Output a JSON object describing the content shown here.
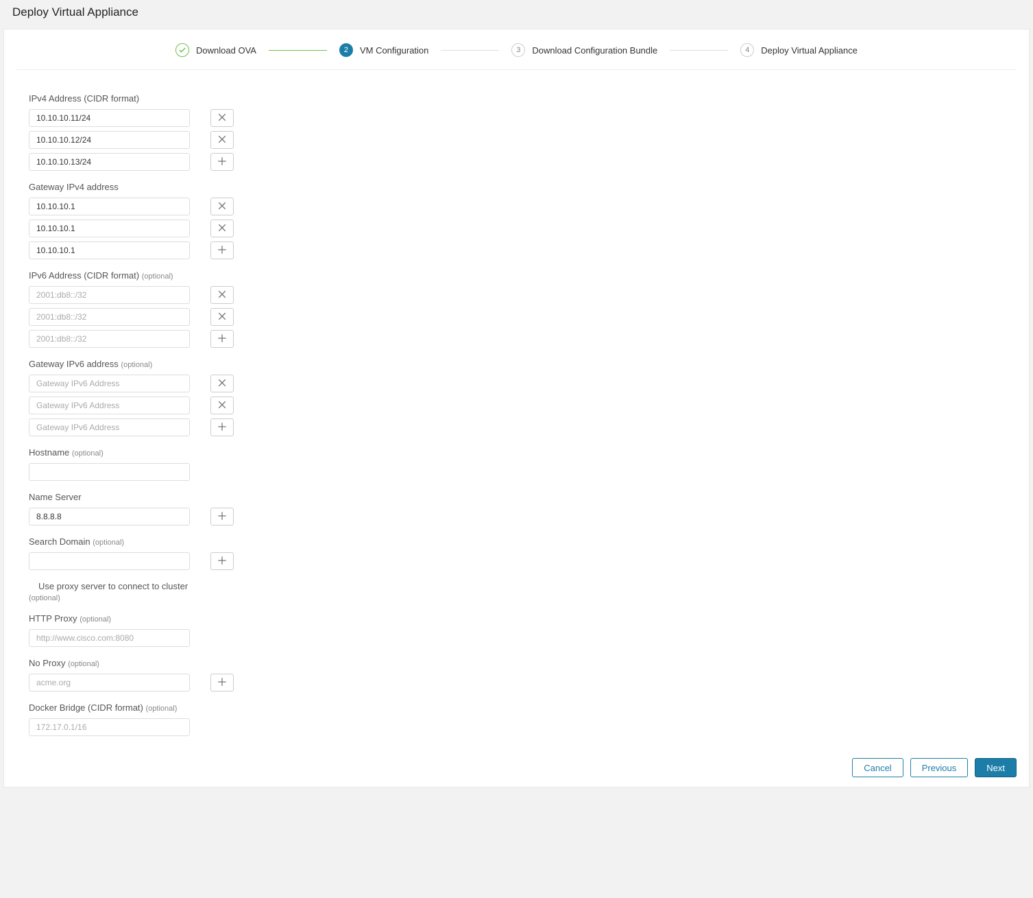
{
  "title": "Deploy Virtual Appliance",
  "steps": {
    "s1": "Download OVA",
    "s2": "VM Configuration",
    "s3": "Download Configuration Bundle",
    "s4": "Deploy Virtual Appliance",
    "n2": "2",
    "n3": "3",
    "n4": "4"
  },
  "labels": {
    "ipv4": "IPv4 Address (CIDR format)",
    "gw4": "Gateway IPv4 address",
    "ipv6": "IPv6 Address (CIDR format)",
    "gw6": "Gateway IPv6 address",
    "host": "Hostname",
    "ns": "Name Server",
    "sd": "Search Domain",
    "proxy_use": "Use proxy server to connect to cluster",
    "httpproxy": "HTTP Proxy",
    "noproxy": "No Proxy",
    "docker": "Docker Bridge (CIDR format)",
    "optional": "(optional)"
  },
  "values": {
    "ipv4": [
      "10.10.10.11/24",
      "10.10.10.12/24",
      "10.10.10.13/24"
    ],
    "gw4": [
      "10.10.10.1",
      "10.10.10.1",
      "10.10.10.1"
    ],
    "ipv6_ph": "2001:db8::/32",
    "gw6_ph": "Gateway IPv6 Address",
    "ns": "8.8.8.8",
    "httpproxy_ph": "http://www.cisco.com:8080",
    "noproxy_ph": "acme.org",
    "docker_ph": "172.17.0.1/16"
  },
  "buttons": {
    "cancel": "Cancel",
    "previous": "Previous",
    "next": "Next"
  }
}
